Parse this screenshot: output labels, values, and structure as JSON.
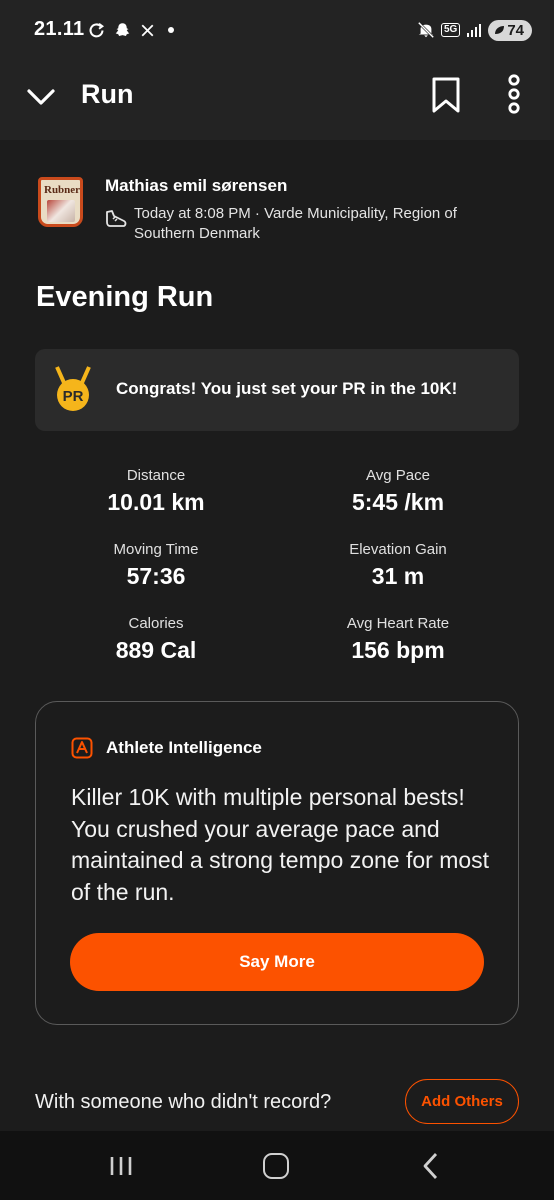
{
  "status_bar": {
    "time": "21.11",
    "network": "5G",
    "battery": "74"
  },
  "header": {
    "title": "Run"
  },
  "athlete": {
    "name": "Mathias emil sørensen",
    "avatar_text": "Rubners",
    "meta": "Today at 8:08 PM · Varde Municipality, Region of Southern Denmark"
  },
  "activity": {
    "title": "Evening Run"
  },
  "pr_banner": {
    "badge": "PR",
    "text": "Congrats! You just set your PR in the 10K!"
  },
  "stats": [
    {
      "label": "Distance",
      "value": "10.01 km"
    },
    {
      "label": "Avg Pace",
      "value": "5:45 /km"
    },
    {
      "label": "Moving Time",
      "value": "57:36"
    },
    {
      "label": "Elevation Gain",
      "value": "31 m"
    },
    {
      "label": "Calories",
      "value": "889 Cal"
    },
    {
      "label": "Avg Heart Rate",
      "value": "156 bpm"
    }
  ],
  "athlete_intelligence": {
    "title": "Athlete Intelligence",
    "body": "Killer 10K with multiple personal bests! You crushed your average pace and maintained a strong tempo zone for most of the run.",
    "button_label": "Say More"
  },
  "add_others": {
    "prompt": "With someone who didn't record?",
    "button_label": "Add Others"
  },
  "colors": {
    "accent": "#fc5200",
    "background": "#1c1c1c",
    "card": "#2b2b2b",
    "medal": "#f5b51b"
  },
  "icons": {
    "back": "chevron-down-icon",
    "bookmark": "bookmark-icon",
    "more": "more-vertical-icon",
    "shoe": "shoe-icon",
    "pr": "pr-medal-icon",
    "ai": "athlete-intelligence-icon"
  }
}
